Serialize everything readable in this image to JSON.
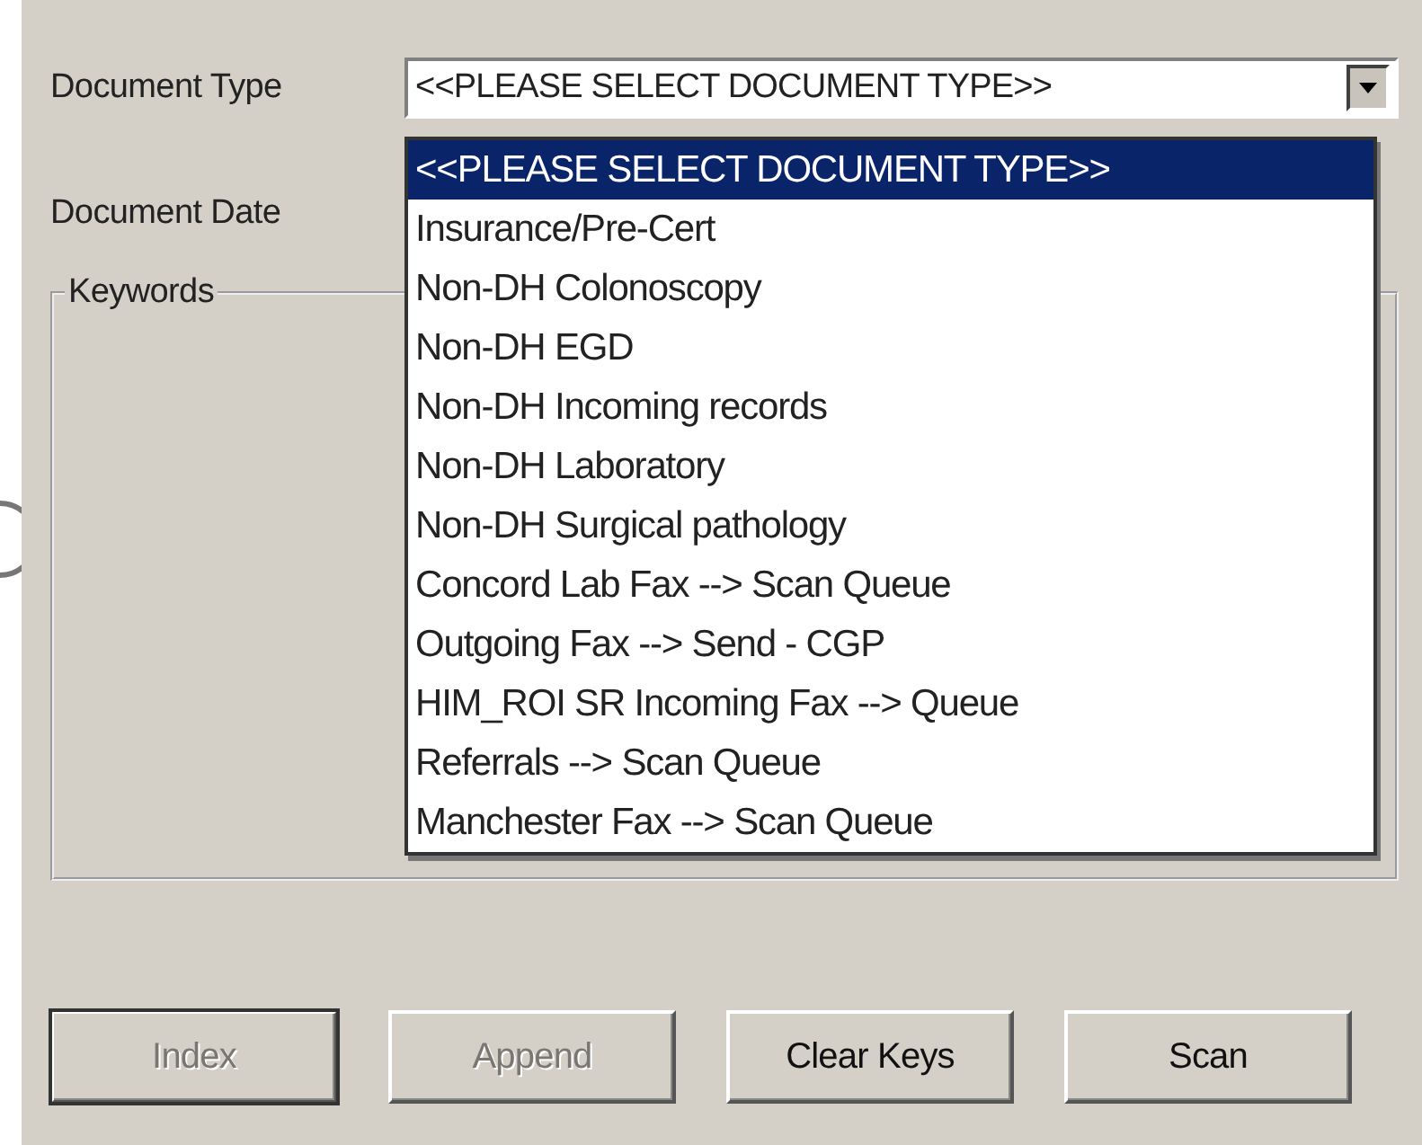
{
  "document_type": {
    "label": "Document Type",
    "value": "<<PLEASE SELECT DOCUMENT TYPE>>",
    "expanded": true,
    "options": [
      {
        "label": "<<PLEASE SELECT DOCUMENT TYPE>>",
        "selected": true
      },
      {
        "label": "Insurance/Pre-Cert",
        "selected": false
      },
      {
        "label": "Non-DH Colonoscopy",
        "selected": false
      },
      {
        "label": "Non-DH EGD",
        "selected": false
      },
      {
        "label": "Non-DH Incoming records",
        "selected": false
      },
      {
        "label": "Non-DH Laboratory",
        "selected": false
      },
      {
        "label": "Non-DH Surgical pathology",
        "selected": false
      },
      {
        "label": "Concord Lab Fax --> Scan Queue",
        "selected": false
      },
      {
        "label": "Outgoing Fax --> Send - CGP",
        "selected": false
      },
      {
        "label": "HIM_ROI SR Incoming Fax --> Queue",
        "selected": false
      },
      {
        "label": "Referrals --> Scan Queue",
        "selected": false
      },
      {
        "label": "Manchester Fax --> Scan Queue",
        "selected": false
      }
    ]
  },
  "document_date": {
    "label": "Document Date"
  },
  "keywords": {
    "title": "Keywords"
  },
  "buttons": [
    {
      "label": "Index",
      "disabled": true,
      "default": true
    },
    {
      "label": "Append",
      "disabled": true,
      "default": false
    },
    {
      "label": "Clear Keys",
      "disabled": false,
      "default": false
    },
    {
      "label": "Scan",
      "disabled": false,
      "default": false
    }
  ]
}
